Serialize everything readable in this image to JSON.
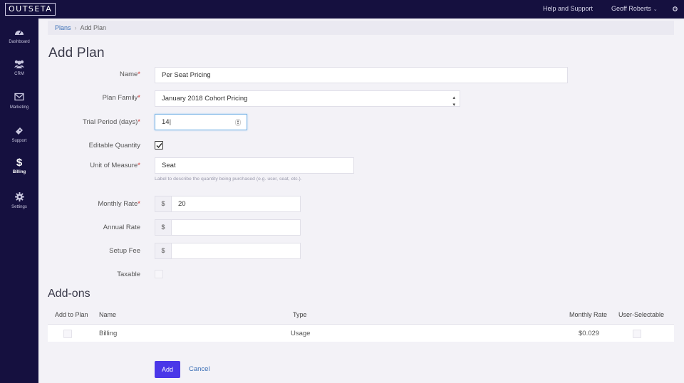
{
  "topbar": {
    "logo": "OUTSETA",
    "help": "Help and Support",
    "user": "Geoff Roberts",
    "user_chevron": "⌄",
    "settings_icon": "gear-icon"
  },
  "sidebar": {
    "items": [
      {
        "label": "Dashboard",
        "icon": "dashboard-icon"
      },
      {
        "label": "CRM",
        "icon": "people-icon"
      },
      {
        "label": "Marketing",
        "icon": "mail-icon"
      },
      {
        "label": "Support",
        "icon": "ticket-icon"
      },
      {
        "label": "Billing",
        "icon": "dollar-icon",
        "active": true
      },
      {
        "label": "Settings",
        "icon": "gear-icon"
      }
    ]
  },
  "breadcrumb": {
    "parent": "Plans",
    "separator": "›",
    "current": "Add Plan"
  },
  "page_title": "Add Plan",
  "form": {
    "name_label": "Name",
    "name_value": "Per Seat Pricing",
    "plan_family_label": "Plan Family",
    "plan_family_value": "January 2018 Cohort Pricing",
    "trial_label": "Trial Period (days)",
    "trial_value": "14",
    "editable_quantity_label": "Editable Quantity",
    "editable_quantity_checked": true,
    "unit_label": "Unit of Measure",
    "unit_value": "Seat",
    "unit_hint": "Label to describe the quantity being purchased (e.g. user, seat, etc.).",
    "monthly_rate_label": "Monthly Rate",
    "monthly_rate_value": "20",
    "annual_rate_label": "Annual Rate",
    "annual_rate_value": "",
    "setup_fee_label": "Setup Fee",
    "setup_fee_value": "",
    "currency_symbol": "$",
    "taxable_label": "Taxable",
    "required_mark": "*"
  },
  "addons": {
    "title": "Add-ons",
    "columns": [
      "Add to Plan",
      "Name",
      "Type",
      "Monthly Rate",
      "User-Selectable"
    ],
    "rows": [
      {
        "name": "Billing",
        "type": "Usage",
        "monthly_rate": "$0.029"
      }
    ]
  },
  "actions": {
    "add": "Add",
    "cancel": "Cancel"
  },
  "colors": {
    "topbar": "#15103f",
    "primary_button": "#4a37e8",
    "link": "#3b6fb6",
    "required": "#d0312d"
  }
}
